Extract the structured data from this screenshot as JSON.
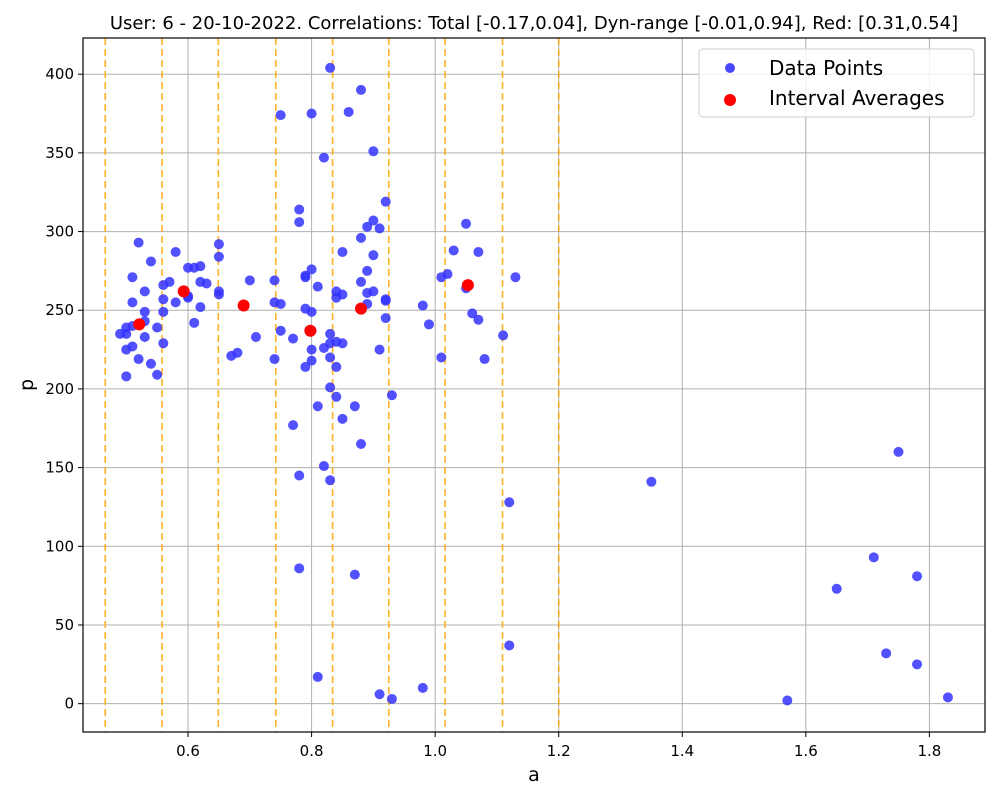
{
  "chart_data": {
    "type": "scatter",
    "title": "User: 6 - 20-10-2022. Correlations: Total [-0.17,0.04], Dyn-range [-0.01,0.94], Red: [0.31,0.54]",
    "xlabel": "a",
    "ylabel": "p",
    "xlim": [
      0.43,
      1.89
    ],
    "ylim": [
      -18,
      423
    ],
    "xticks": [
      0.6,
      0.8,
      1.0,
      1.2,
      1.4,
      1.6,
      1.8
    ],
    "xtick_labels": [
      "0.6",
      "0.8",
      "1.0",
      "1.2",
      "1.4",
      "1.6",
      "1.8"
    ],
    "yticks": [
      0,
      50,
      100,
      150,
      200,
      250,
      300,
      350,
      400
    ],
    "ytick_labels": [
      "0",
      "50",
      "100",
      "150",
      "200",
      "250",
      "300",
      "350",
      "400"
    ],
    "grid": true,
    "legend_position": "top-right",
    "interval_boundaries": [
      0.466,
      0.558,
      0.649,
      0.742,
      0.834,
      0.925,
      1.016,
      1.109,
      1.2
    ],
    "colors": {
      "data_points": "#3333ff",
      "interval_averages": "#ff0000",
      "interval_lines": "#ffa500",
      "grid": "#b0b0b0"
    },
    "series": [
      {
        "name": "Data Points",
        "points": [
          [
            0.49,
            235
          ],
          [
            0.5,
            239
          ],
          [
            0.5,
            235
          ],
          [
            0.5,
            225
          ],
          [
            0.5,
            208
          ],
          [
            0.51,
            271
          ],
          [
            0.51,
            255
          ],
          [
            0.51,
            240
          ],
          [
            0.51,
            227
          ],
          [
            0.52,
            293
          ],
          [
            0.52,
            219
          ],
          [
            0.53,
            262
          ],
          [
            0.53,
            249
          ],
          [
            0.53,
            243
          ],
          [
            0.53,
            233
          ],
          [
            0.54,
            281
          ],
          [
            0.54,
            216
          ],
          [
            0.55,
            239
          ],
          [
            0.55,
            209
          ],
          [
            0.56,
            266
          ],
          [
            0.56,
            257
          ],
          [
            0.56,
            249
          ],
          [
            0.56,
            229
          ],
          [
            0.57,
            268
          ],
          [
            0.58,
            287
          ],
          [
            0.58,
            255
          ],
          [
            0.6,
            277
          ],
          [
            0.6,
            259
          ],
          [
            0.6,
            258
          ],
          [
            0.61,
            277
          ],
          [
            0.61,
            242
          ],
          [
            0.62,
            278
          ],
          [
            0.62,
            268
          ],
          [
            0.62,
            252
          ],
          [
            0.63,
            267
          ],
          [
            0.65,
            292
          ],
          [
            0.65,
            284
          ],
          [
            0.65,
            262
          ],
          [
            0.65,
            260
          ],
          [
            0.67,
            221
          ],
          [
            0.68,
            223
          ],
          [
            0.7,
            269
          ],
          [
            0.71,
            233
          ],
          [
            0.74,
            269
          ],
          [
            0.74,
            255
          ],
          [
            0.74,
            219
          ],
          [
            0.75,
            374
          ],
          [
            0.75,
            254
          ],
          [
            0.75,
            237
          ],
          [
            0.77,
            232
          ],
          [
            0.77,
            177
          ],
          [
            0.78,
            314
          ],
          [
            0.78,
            306
          ],
          [
            0.78,
            145
          ],
          [
            0.78,
            86
          ],
          [
            0.79,
            272
          ],
          [
            0.79,
            271
          ],
          [
            0.79,
            251
          ],
          [
            0.79,
            214
          ],
          [
            0.8,
            375
          ],
          [
            0.8,
            276
          ],
          [
            0.8,
            249
          ],
          [
            0.8,
            237
          ],
          [
            0.8,
            225
          ],
          [
            0.8,
            218
          ],
          [
            0.81,
            265
          ],
          [
            0.81,
            189
          ],
          [
            0.81,
            17
          ],
          [
            0.82,
            347
          ],
          [
            0.82,
            226
          ],
          [
            0.82,
            151
          ],
          [
            0.83,
            404
          ],
          [
            0.83,
            235
          ],
          [
            0.83,
            229
          ],
          [
            0.83,
            220
          ],
          [
            0.83,
            201
          ],
          [
            0.83,
            142
          ],
          [
            0.84,
            262
          ],
          [
            0.84,
            258
          ],
          [
            0.84,
            230
          ],
          [
            0.84,
            214
          ],
          [
            0.84,
            195
          ],
          [
            0.85,
            287
          ],
          [
            0.85,
            260
          ],
          [
            0.85,
            229
          ],
          [
            0.85,
            181
          ],
          [
            0.86,
            376
          ],
          [
            0.87,
            189
          ],
          [
            0.87,
            82
          ],
          [
            0.88,
            390
          ],
          [
            0.88,
            296
          ],
          [
            0.88,
            268
          ],
          [
            0.88,
            251
          ],
          [
            0.88,
            165
          ],
          [
            0.89,
            303
          ],
          [
            0.89,
            275
          ],
          [
            0.89,
            261
          ],
          [
            0.89,
            254
          ],
          [
            0.9,
            351
          ],
          [
            0.9,
            307
          ],
          [
            0.9,
            285
          ],
          [
            0.9,
            262
          ],
          [
            0.91,
            302
          ],
          [
            0.91,
            225
          ],
          [
            0.91,
            6
          ],
          [
            0.92,
            319
          ],
          [
            0.92,
            257
          ],
          [
            0.92,
            256
          ],
          [
            0.92,
            245
          ],
          [
            0.93,
            196
          ],
          [
            0.93,
            3
          ],
          [
            0.98,
            253
          ],
          [
            0.98,
            10
          ],
          [
            0.99,
            241
          ],
          [
            1.01,
            271
          ],
          [
            1.01,
            220
          ],
          [
            1.02,
            273
          ],
          [
            1.03,
            288
          ],
          [
            1.05,
            305
          ],
          [
            1.05,
            264
          ],
          [
            1.06,
            248
          ],
          [
            1.07,
            287
          ],
          [
            1.07,
            244
          ],
          [
            1.08,
            219
          ],
          [
            1.11,
            234
          ],
          [
            1.12,
            128
          ],
          [
            1.12,
            37
          ],
          [
            1.13,
            271
          ],
          [
            1.35,
            141
          ],
          [
            1.57,
            2
          ],
          [
            1.65,
            73
          ],
          [
            1.71,
            93
          ],
          [
            1.73,
            32
          ],
          [
            1.75,
            160
          ],
          [
            1.78,
            81
          ],
          [
            1.78,
            25
          ],
          [
            1.83,
            4
          ]
        ]
      },
      {
        "name": "Interval Averages",
        "points": [
          [
            0.521,
            241
          ],
          [
            0.593,
            262
          ],
          [
            0.69,
            253
          ],
          [
            0.798,
            237
          ],
          [
            0.88,
            251
          ],
          [
            1.053,
            266
          ]
        ]
      }
    ]
  },
  "legend": {
    "items": [
      {
        "label": "Data Points"
      },
      {
        "label": "Interval Averages"
      }
    ]
  }
}
